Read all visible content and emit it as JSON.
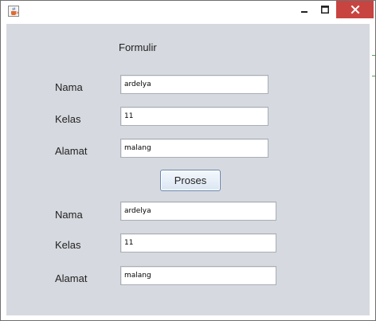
{
  "window": {
    "title": "",
    "icon": "java-cup-icon",
    "controls": {
      "minimize": "minimize-icon",
      "maximize": "maximize-icon",
      "close": "close-icon"
    },
    "colors": {
      "client_bg": "#d6d9df",
      "close_bg": "#c84441"
    }
  },
  "form": {
    "heading": "Formulir",
    "input": {
      "nama_label": "Nama",
      "nama_value": "ardelya",
      "kelas_label": "Kelas",
      "kelas_value": "11",
      "alamat_label": "Alamat",
      "alamat_value": "malang"
    },
    "button_label": "Proses",
    "output": {
      "nama_label": "Nama",
      "nama_value": "ardelya",
      "kelas_label": "Kelas",
      "kelas_value": "11",
      "alamat_label": "Alamat",
      "alamat_value": "malang"
    }
  }
}
